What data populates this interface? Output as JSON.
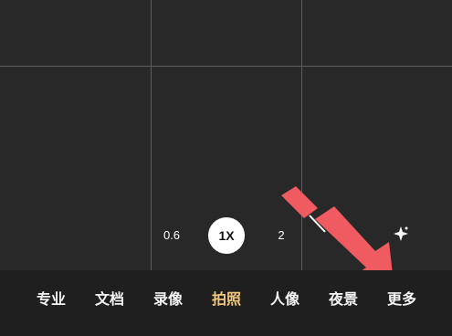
{
  "camera": {
    "zoom_options": [
      "0.6",
      "1X",
      "2"
    ],
    "selected_zoom": "1X",
    "spark_icon": "sparkle-icon"
  },
  "modes": [
    "专业",
    "文档",
    "录像",
    "拍照",
    "人像",
    "夜景",
    "更多"
  ],
  "selected_mode": "拍照",
  "colors": {
    "background": "#242424",
    "grid": "#5f5f5f",
    "active_mode": "#f1c879",
    "annotation_arrow": "#ef5b61"
  }
}
